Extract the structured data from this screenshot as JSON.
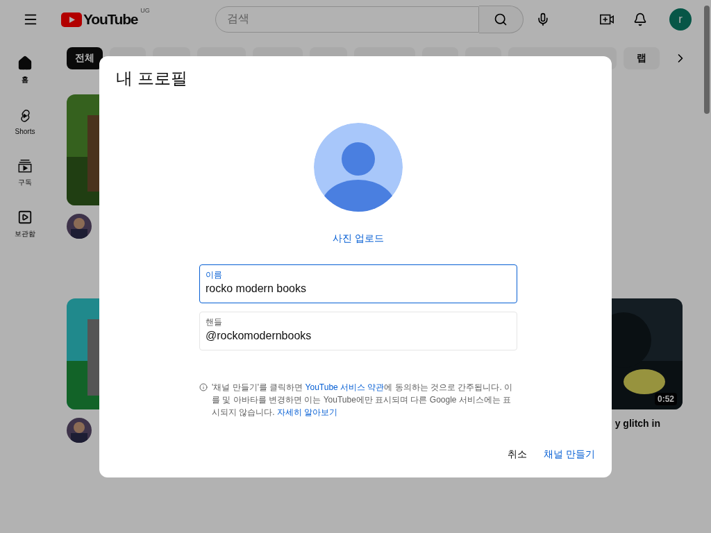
{
  "topbar": {
    "logo_text": "YouTube",
    "region": "UG",
    "search": {
      "placeholder": "검색"
    },
    "avatar_letter": "r"
  },
  "sidebar": {
    "items": [
      {
        "kind": "home",
        "label": "홈",
        "selected": true
      },
      {
        "kind": "shorts",
        "label": "Shorts",
        "selected": false
      },
      {
        "kind": "subscriptions",
        "label": "구독",
        "selected": false
      },
      {
        "kind": "library",
        "label": "보관함",
        "selected": false
      }
    ]
  },
  "chips": [
    {
      "label": "전체",
      "selected": true
    },
    {
      "selected": false
    },
    {
      "selected": false
    },
    {
      "selected": false
    },
    {
      "selected": false
    },
    {
      "selected": false
    },
    {
      "selected": false
    },
    {
      "selected": false
    },
    {
      "selected": false
    },
    {
      "selected": false
    },
    {
      "label": "랩",
      "selected": false
    }
  ],
  "videos": [
    {
      "kind": "picture"
    },
    {
      "kind": "picture"
    },
    {
      "kind": "picture",
      "duration": "0:52",
      "title": "y glitch in"
    }
  ],
  "dialog": {
    "title": "내 프로필",
    "upload_link": "사진 업로드",
    "fields": [
      {
        "label": "이름",
        "value": "rocko modern books",
        "focused": true
      },
      {
        "label": "핸들",
        "value": "@rockomodernbooks",
        "focused": false
      }
    ],
    "notice": [
      {
        "text": "'채널 만들기'를 클릭하면 ",
        "link": false
      },
      {
        "text": "YouTube 서비스 약관",
        "link": true
      },
      {
        "text": "에 동의하는 것으로 간주됩니다. 이를 및 아바타를 변경하면 이는 YouTube에만 표시되며 다른 Google 서비스에는 표시되지 않습니다. ",
        "link": false
      },
      {
        "text": "자세히 알아보기",
        "link": true
      }
    ],
    "buttons": [
      {
        "label": "취소",
        "kind": "cancel"
      },
      {
        "label": "채널 만들기",
        "kind": "primary"
      }
    ]
  }
}
